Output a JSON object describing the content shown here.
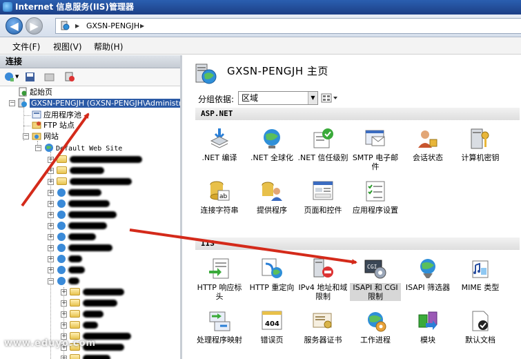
{
  "window": {
    "title": "Internet 信息服务(IIS)管理器"
  },
  "address": {
    "crumb": "GXSN-PENGJH"
  },
  "menu": {
    "file": "文件(F)",
    "view": "视图(V)",
    "help": "帮助(H)"
  },
  "connections": {
    "header": "连接",
    "tree": {
      "start_page": "起始页",
      "server": "GXSN-PENGJH (GXSN-PENGJH\\Administra",
      "app_pools": "应用程序池",
      "ftp_sites": "FTP 站点",
      "sites": "网站",
      "default_site": "Default Web Site"
    }
  },
  "home": {
    "title": "GXSN-PENGJH 主页",
    "group_label": "分组依据:",
    "group_value": "区域"
  },
  "sections": {
    "aspnet": "ASP.NET",
    "iis": "IIS"
  },
  "features": {
    "aspnet": [
      ".NET 编译",
      ".NET 全球化",
      ".NET 信任级别",
      "SMTP 电子邮件",
      "会话状态",
      "计算机密钥",
      "连接字符串",
      "提供程序",
      "页面和控件",
      "应用程序设置"
    ],
    "iis": [
      "HTTP 响应标头",
      "HTTP 重定向",
      "IPv4 地址和域限制",
      "ISAPI 和 CGI 限制",
      "ISAPI 筛选器",
      "MIME 类型",
      "处理程序映射",
      "错误页",
      "服务器证书",
      "工作进程",
      "模块",
      "默认文档"
    ]
  },
  "watermark": "www.eduyo.com",
  "colors": {
    "titlebar": "#2a5fb0",
    "selection": "#2b5aa6",
    "arrow": "#d42a1a"
  }
}
